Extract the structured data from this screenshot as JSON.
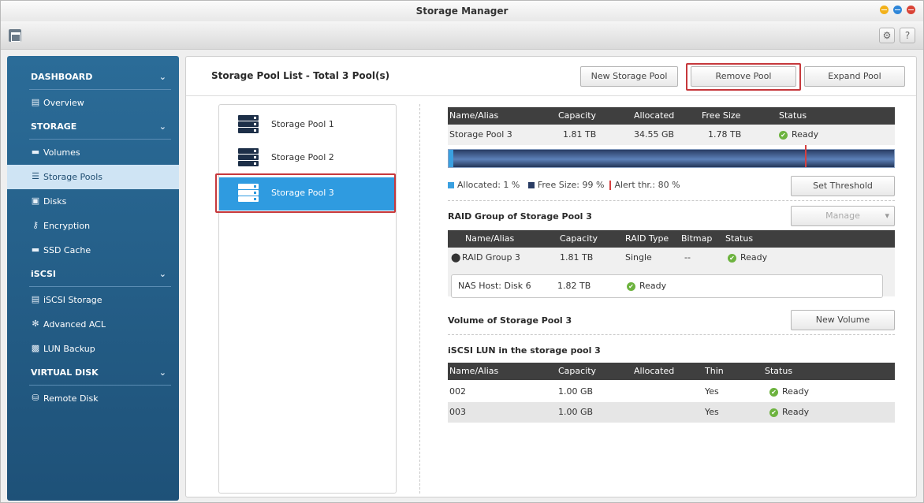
{
  "window": {
    "title": "Storage Manager"
  },
  "sidebar": {
    "sections": [
      {
        "label": "DASHBOARD",
        "items": [
          {
            "label": "Overview"
          }
        ]
      },
      {
        "label": "STORAGE",
        "items": [
          {
            "label": "Volumes"
          },
          {
            "label": "Storage Pools"
          },
          {
            "label": "Disks"
          },
          {
            "label": "Encryption"
          },
          {
            "label": "SSD Cache"
          }
        ]
      },
      {
        "label": "iSCSI",
        "items": [
          {
            "label": "iSCSI Storage"
          },
          {
            "label": "Advanced ACL"
          },
          {
            "label": "LUN Backup"
          }
        ]
      },
      {
        "label": "VIRTUAL DISK",
        "items": [
          {
            "label": "Remote Disk"
          }
        ]
      }
    ]
  },
  "main": {
    "title": "Storage Pool List - Total 3 Pool(s)",
    "buttons": {
      "new_pool": "New Storage Pool",
      "remove_pool": "Remove Pool",
      "expand_pool": "Expand Pool"
    },
    "pools": [
      "Storage Pool 1",
      "Storage Pool 2",
      "Storage Pool 3"
    ],
    "pool_table": {
      "headers": [
        "Name/Alias",
        "Capacity",
        "Allocated",
        "Free Size",
        "Status"
      ],
      "row": [
        "Storage Pool 3",
        "1.81 TB",
        "34.55 GB",
        "1.78 TB",
        "Ready"
      ]
    },
    "usage": {
      "allocated_pct": 1,
      "alert_pct": 80
    },
    "legend": {
      "allocated": "Allocated: 1 %",
      "free": "Free Size: 99 %",
      "alert": "Alert thr.: 80 %"
    },
    "set_threshold": "Set Threshold",
    "raid": {
      "title": "RAID Group of Storage Pool 3",
      "manage": "Manage",
      "headers": [
        "Name/Alias",
        "Capacity",
        "RAID Type",
        "Bitmap",
        "Status"
      ],
      "row": [
        "RAID Group 3",
        "1.81 TB",
        "Single",
        "--",
        "Ready"
      ],
      "disk": [
        "NAS Host: Disk 6",
        "1.82 TB",
        "Ready"
      ]
    },
    "volume": {
      "title": "Volume of Storage Pool 3",
      "new_volume": "New Volume"
    },
    "lun": {
      "title": "iSCSI LUN in the storage pool 3",
      "headers": [
        "Name/Alias",
        "Capacity",
        "Allocated",
        "Thin",
        "Status"
      ],
      "rows": [
        [
          "002",
          "1.00 GB",
          "",
          "Yes",
          "Ready"
        ],
        [
          "003",
          "1.00 GB",
          "",
          "Yes",
          "Ready"
        ]
      ]
    }
  },
  "colors": {
    "sidebar": "#1e5178",
    "selected_pool": "#2f9be0",
    "highlight": "#c6383c",
    "ready": "#6db33f"
  }
}
